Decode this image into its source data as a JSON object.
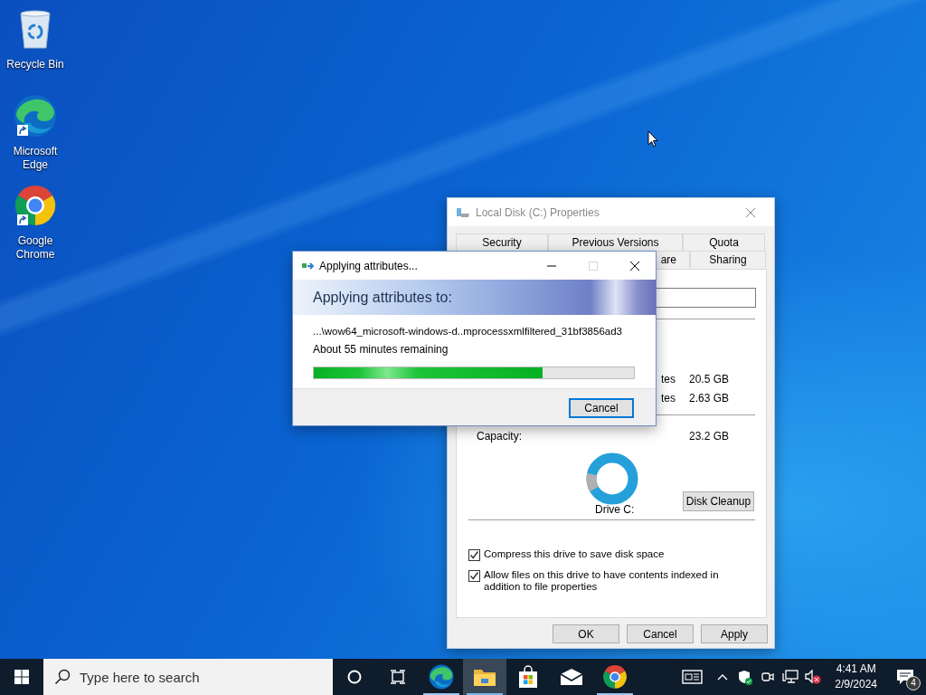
{
  "desktop_icons": [
    {
      "kind": "recycle",
      "label": "Recycle Bin",
      "shortcut": false
    },
    {
      "kind": "edge",
      "label": "Microsoft Edge",
      "shortcut": true
    },
    {
      "kind": "chrome",
      "label": "Google Chrome",
      "shortcut": true
    }
  ],
  "properties_window": {
    "title": "Local Disk (C:) Properties",
    "tab_rows": [
      [
        "Security",
        "Previous Versions",
        "Quota"
      ],
      [
        "are",
        "Sharing"
      ]
    ],
    "usage_rows": [
      {
        "bytes": "tes",
        "size": "20.5 GB"
      },
      {
        "bytes": "tes",
        "size": "2.63 GB"
      }
    ],
    "capacity": {
      "label": "Capacity:",
      "size": "23.2 GB"
    },
    "drive_label": "Drive C:",
    "cleanup_button": "Disk Cleanup",
    "options": [
      {
        "label": "Compress this drive to save disk space",
        "checked": true
      },
      {
        "label": "Allow files on this drive to have contents indexed in addition to file properties",
        "checked": true
      }
    ],
    "buttons": [
      "OK",
      "Cancel",
      "Apply"
    ]
  },
  "progress_dialog": {
    "title": "Applying attributes...",
    "heading": "Applying attributes to:",
    "path": "...\\wow64_microsoft-windows-d..mprocessxmlfiltered_31bf3856ad3",
    "remaining": "About 55 minutes remaining",
    "level": 0.715,
    "button": "Cancel"
  },
  "taskbar": {
    "search": {
      "placeholder": "Type here to search"
    },
    "apps": [
      {
        "kind": "edge",
        "running": true,
        "active": false
      },
      {
        "kind": "explorer",
        "running": true,
        "active": true
      },
      {
        "kind": "store",
        "running": false,
        "active": false
      },
      {
        "kind": "mail",
        "running": false,
        "active": false
      },
      {
        "kind": "chrome",
        "running": true,
        "active": false
      }
    ],
    "time": "4:41 AM",
    "date": "2/9/2024",
    "notification_count": "4"
  }
}
